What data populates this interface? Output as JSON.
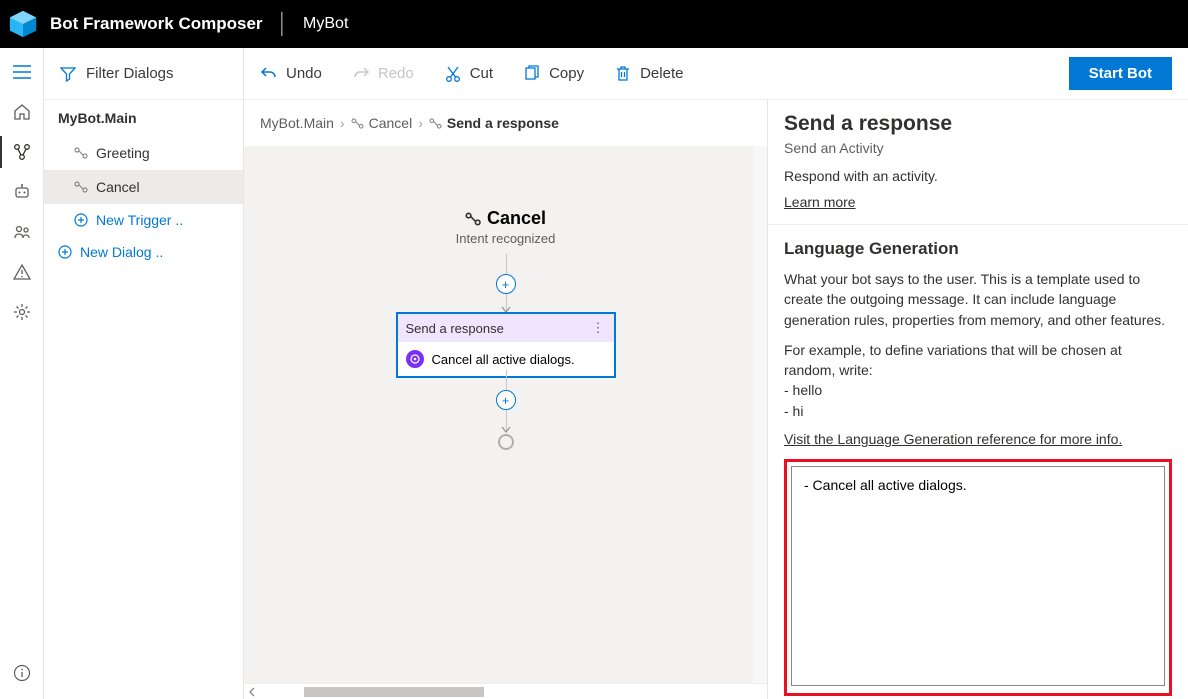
{
  "header": {
    "app_title": "Bot Framework Composer",
    "project_name": "MyBot"
  },
  "nav": {
    "filter_label": "Filter Dialogs",
    "root_dialog": "MyBot.Main",
    "triggers": [
      {
        "name": "Greeting"
      },
      {
        "name": "Cancel"
      }
    ],
    "new_trigger": "New Trigger ..",
    "new_dialog": "New Dialog .."
  },
  "commands": {
    "undo": "Undo",
    "redo": "Redo",
    "cut": "Cut",
    "copy": "Copy",
    "delete": "Delete",
    "start_bot": "Start Bot"
  },
  "breadcrumb": {
    "root": "MyBot.Main",
    "trigger": "Cancel",
    "action": "Send a response"
  },
  "canvas": {
    "trigger_name": "Cancel",
    "trigger_sub": "Intent recognized",
    "node_title": "Send a response",
    "node_body": "Cancel all active dialogs."
  },
  "properties": {
    "title": "Send a response",
    "subtitle": "Send an Activity",
    "description": "Respond with an activity.",
    "learn_more": "Learn more",
    "lg_heading": "Language Generation",
    "lg_para1": "What your bot says to the user. This is a template used to create the outgoing message. It can include language generation rules, properties from memory, and other features.",
    "lg_para2": "For example, to define variations that will be chosen at random, write:",
    "lg_ex1": "- hello",
    "lg_ex2": "- hi",
    "lg_ref_link": "Visit the Language Generation reference for more info.",
    "lg_value": "- Cancel all active dialogs."
  }
}
